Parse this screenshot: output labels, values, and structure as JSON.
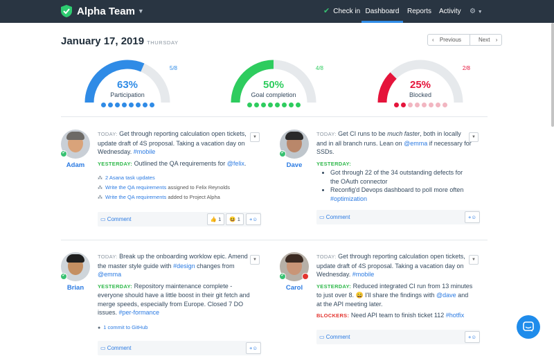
{
  "nav": {
    "brand": "Alpha Team",
    "checkin": "Check in",
    "dashboard": "Dashboard",
    "reports": "Reports",
    "activity": "Activity"
  },
  "header": {
    "date": "January 17, 2019",
    "weekday": "THURSDAY",
    "previous": "Previous",
    "next": "Next"
  },
  "gauges": [
    {
      "pct_text": "63%",
      "fraction_text": "5/8",
      "label": "Participation",
      "value": 0.63,
      "count": 5,
      "total": 8,
      "color": "#2f8be6",
      "dot_off": "#2f8be6"
    },
    {
      "pct_text": "50%",
      "fraction_text": "4/8",
      "label": "Goal completion",
      "value": 0.5,
      "count": 4,
      "total": 8,
      "color": "#2ecc5e",
      "dot_off": "#2ecc5e"
    },
    {
      "pct_text": "25%",
      "fraction_text": "2/8",
      "label": "Blocked",
      "value": 0.25,
      "count": 2,
      "total": 8,
      "color": "#e5143b",
      "dot_off": "#f2b6c1"
    }
  ],
  "cards": {
    "adam": {
      "name": "Adam",
      "today_label": "TODAY:",
      "today_text": "Get through reporting calculation open tickets, update draft of 4S proposal. Taking a vacation day on Wednesday.",
      "today_tag": "#mobile",
      "yest_label": "YESTERDAY:",
      "yest_text": "Outlined the QA requirements for",
      "yest_mention": "@felix",
      "yest_end": ".",
      "asana": "2 Asana task updates",
      "task1_link": "Write the QA requirements",
      "task1_rest": "assigned to Felix Reynolds",
      "task2_link": "Write the QA requirements",
      "task2_rest": "added to Project Alpha",
      "comment": "Comment",
      "thumbs_count": "1",
      "smile_count": "1"
    },
    "dave": {
      "name": "Dave",
      "today_label": "TODAY:",
      "t1": "Get CI runs to be",
      "t_em": "much faster",
      "t2": ", both in locally and in all branch runs. Lean on",
      "t_mention": "@emma",
      "t3": "if necessary for SSDs.",
      "yest_label": "YESTERDAY:",
      "b1": "Got through 22 of the 34 outstanding defects for the OAuth connector",
      "b2": "Reconfig'd Devops dashboard to poll more often",
      "b2_tag": "#optimization",
      "comment": "Comment"
    },
    "brian": {
      "name": "Brian",
      "today_label": "TODAY:",
      "t1": "Break up the onboarding worklow epic. Amend the master style guide with",
      "t_tag": "#design",
      "t2": "changes from",
      "t_mention": "@emma",
      "yest_label": "YESTERDAY:",
      "y1": "Repository maintenance complete - everyone should have a little boost in their git fetch and merge speeds, especially from Europe. Closed 7 DO issues.",
      "y_tag": "#per-formance",
      "commit": "1 commit to GitHub",
      "comment": "Comment"
    },
    "carol": {
      "name": "Carol",
      "today_label": "TODAY:",
      "today_text": "Get through reporting calculation open tickets, update draft of 4S proposal. Taking a vacation day on Wednesday.",
      "today_tag": "#mobile",
      "yest_label": "YESTERDAY:",
      "y1": "Reduced integrated CI run from 13 minutes to just over 8. 😄 I'll share the findings with",
      "y_mention": "@dave",
      "y2": "and at the API meeting later.",
      "block_label": "BLOCKERS:",
      "block_text": "Need API team to finish ticket 112",
      "block_tag": "#hotfix",
      "comment": "Comment"
    }
  },
  "add_reaction": "+☺"
}
